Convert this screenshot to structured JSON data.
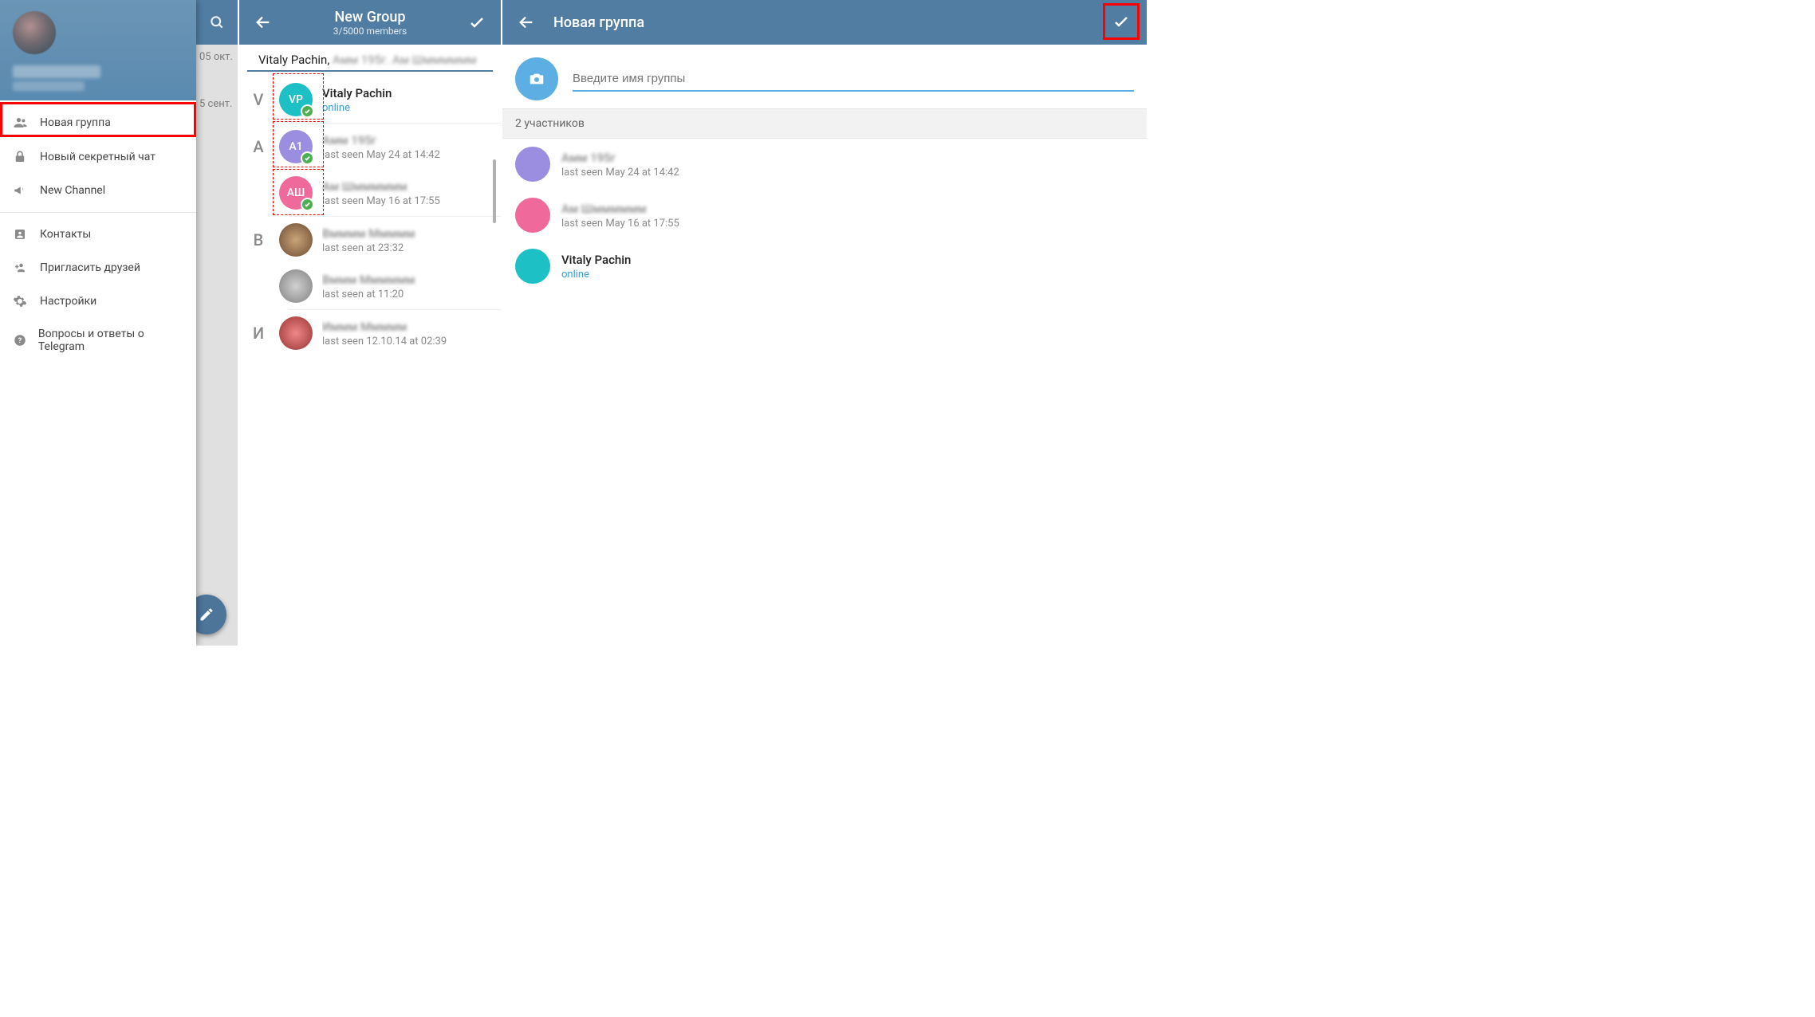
{
  "panel1": {
    "bg": {
      "date1": "05 окт.",
      "date2": "5 сент."
    },
    "menu": {
      "new_group": "Новая группа",
      "new_secret_chat": "Новый секретный чат",
      "new_channel": "New Channel",
      "contacts": "Контакты",
      "invite_friends": "Пригласить друзей",
      "settings": "Настройки",
      "faq": "Вопросы и ответы о Telegram"
    }
  },
  "panel2": {
    "title": "New Group",
    "subtitle": "3/5000 members",
    "selected_text": "Vitaly Pachin,",
    "letters": {
      "V": "V",
      "A": "A",
      "B": "B",
      "I": "И"
    },
    "contacts": [
      {
        "initials": "VP",
        "color": "#1cc0c5",
        "name": "Vitaly Pachin",
        "status": "online",
        "online": true
      },
      {
        "initials": "А1",
        "color": "#9b8de0",
        "name": "——",
        "status": "last seen May 24 at 14:42",
        "online": false
      },
      {
        "initials": "АШ",
        "color": "#ef6a9a",
        "name": "——",
        "status": "last seen May 16 at 17:55",
        "online": false
      },
      {
        "initials": "",
        "color": "#9a7a60",
        "name": "——",
        "status": "last seen at 23:32",
        "online": false
      },
      {
        "initials": "",
        "color": "#b0b0b0",
        "name": "——",
        "status": "last seen at 11:20",
        "online": false
      },
      {
        "initials": "",
        "color": "#c070a0",
        "name": "——",
        "status": "last seen 12.10.14 at 02:39",
        "online": false
      }
    ]
  },
  "panel3": {
    "title": "Новая группа",
    "input_placeholder": "Введите имя группы",
    "members_label": "2 участников",
    "members": [
      {
        "color": "#9b8de0",
        "name": "——",
        "status": "last seen May 24 at 14:42",
        "online": false
      },
      {
        "color": "#ef6a9a",
        "name": "——",
        "status": "last seen May 16 at 17:55",
        "online": false
      },
      {
        "color": "#1cc0c5",
        "name": "Vitaly Pachin",
        "status": "online",
        "online": true
      }
    ]
  }
}
